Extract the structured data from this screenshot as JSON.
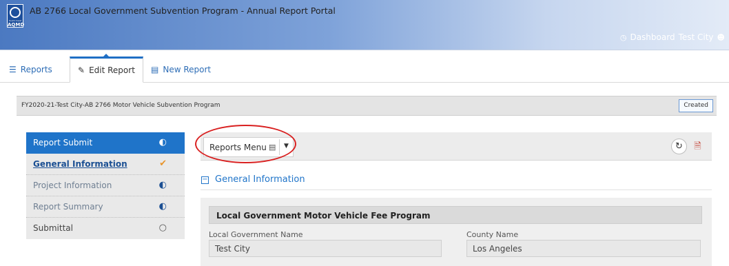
{
  "app": {
    "title": "AB 2766 Local Government Subvention Program - Annual Report Portal",
    "logo_small": "South Coast",
    "logo_text": "AQMD",
    "dashboard_label": "Dashboard",
    "user": "Test City"
  },
  "tabs": [
    {
      "label": "Reports",
      "icon": "list-icon"
    },
    {
      "label": "Edit Report",
      "icon": "edit-icon",
      "active": true
    },
    {
      "label": "New Report",
      "icon": "document-icon"
    }
  ],
  "breadcrumb": {
    "text": "FY2020-21-Test City-AB 2766 Motor Vehicle Subvention Program",
    "status": "Created"
  },
  "sidebar": {
    "items": [
      {
        "label": "Report Submit",
        "icon": "half-circle-icon"
      },
      {
        "label": "General Information",
        "icon": "check-circle-icon",
        "current": true
      },
      {
        "label": "Project Information",
        "icon": "half-circle-icon"
      },
      {
        "label": "Report Summary",
        "icon": "half-circle-icon"
      },
      {
        "label": "Submittal",
        "icon": "empty-circle-icon"
      }
    ]
  },
  "toolbar": {
    "menu_label": "Reports Menu",
    "refresh_icon": "refresh-icon",
    "pdf_icon": "pdf-icon"
  },
  "section": {
    "title": "General Information",
    "form_title": "Local Government Motor Vehicle Fee Program",
    "fields": [
      {
        "label": "Local Government Name",
        "value": "Test City"
      },
      {
        "label": "County Name",
        "value": "Los Angeles"
      }
    ]
  },
  "colors": {
    "accent": "#1f74c9",
    "annotation": "#d92020"
  }
}
